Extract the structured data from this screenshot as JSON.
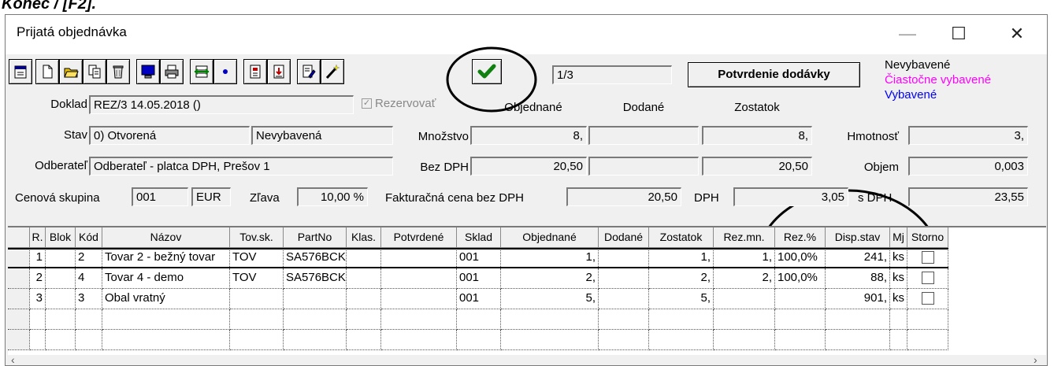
{
  "caption": "Konec / [F2].",
  "window": {
    "title": "Prijatá objednávka",
    "min_glyph": "—",
    "max_glyph": "☐",
    "close_glyph": "✕"
  },
  "toolbar": {
    "counter": "1/3",
    "confirm_button": "Potvrdenie dodávky",
    "icons": [
      "calendar-icon",
      "new-document-icon",
      "open-folder-icon",
      "copy-icon",
      "recycle-icon",
      "monitor-icon",
      "printer-icon",
      "move-rows-icon",
      "dot-icon",
      "report-icon",
      "export-icon",
      "edit-document-icon",
      "magic-wand-icon",
      "checkmark-icon"
    ]
  },
  "legend": {
    "items": [
      {
        "label": "Nevybavené",
        "color": "#000000"
      },
      {
        "label": "Čiastočne vybavené",
        "color": "#ff00ff"
      },
      {
        "label": "Vybavené",
        "color": "#0000ff"
      }
    ]
  },
  "form": {
    "doklad_label": "Doklad",
    "doklad_value": "REZ/3 14.05.2018 ()",
    "rezervovat_label": "Rezervovať",
    "rezervovat_checked": true,
    "stav_label": "Stav",
    "stav_value": "0) Otvorená",
    "stav_status": "Nevybavená",
    "odberatel_label": "Odberateľ",
    "odberatel_value": "Odberateľ - platca DPH, Prešov 1",
    "cenova_label": "Cenová skupina",
    "cenova_value": "001",
    "mena_value": "EUR",
    "zlava_label": "Zľava",
    "zlava_value": "10,00 %",
    "fakt_label": "Fakturačná cena bez DPH",
    "fakt_value": "20,50",
    "dph_label": "DPH",
    "dph_value": "3,05",
    "s_dph_label": "s DPH",
    "s_dph_value": "23,55",
    "col_objednane": "Objednané",
    "col_dodane": "Dodané",
    "col_zostatok": "Zostatok",
    "mnozstvo_label": "Množstvo",
    "mnozstvo_obj": "8,",
    "mnozstvo_dod": "",
    "mnozstvo_zost": "8,",
    "bezdph_label": "Bez DPH",
    "bezdph_obj": "20,50",
    "bezdph_dod": "",
    "bezdph_zost": "20,50",
    "hmotnost_label": "Hmotnosť",
    "hmotnost_value": "3,",
    "objem_label": "Objem",
    "objem_value": "0,003"
  },
  "table": {
    "headers": [
      "R.",
      "Blok",
      "Kód",
      "Názov",
      "Tov.sk.",
      "PartNo",
      "Klas.",
      "Potvrdené",
      "Sklad",
      "Objednané",
      "Dodané",
      "Zostatok",
      "Rez.mn.",
      "Rez.%",
      "Disp.stav",
      "Mj",
      "Storno"
    ],
    "rows": [
      {
        "r": "1",
        "blok": "",
        "kod": "2",
        "nazov": "Tovar 2 - bežný tovar",
        "tovsk": "TOV",
        "partno": "SA576BCK",
        "klas": "",
        "potvrdene": "",
        "sklad": "001",
        "objednane": "1,",
        "dodane": "",
        "zostatok": "1,",
        "rezmn": "1,",
        "rezpct": "100,0%",
        "disp": "241,",
        "mj": "ks",
        "storno": false
      },
      {
        "r": "2",
        "blok": "",
        "kod": "4",
        "nazov": "Tovar 4 - demo",
        "tovsk": "TOV",
        "partno": "SA576BCK",
        "klas": "",
        "potvrdene": "",
        "sklad": "001",
        "objednane": "2,",
        "dodane": "",
        "zostatok": "2,",
        "rezmn": "2,",
        "rezpct": "100,0%",
        "disp": "88,",
        "mj": "ks",
        "storno": false
      },
      {
        "r": "3",
        "blok": "",
        "kod": "3",
        "nazov": "Obal vratný",
        "tovsk": "",
        "partno": "",
        "klas": "",
        "potvrdene": "",
        "sklad": "001",
        "objednane": "5,",
        "dodane": "",
        "zostatok": "5,",
        "rezmn": "",
        "rezpct": "",
        "disp": "901,",
        "mj": "ks",
        "storno": false
      }
    ]
  }
}
